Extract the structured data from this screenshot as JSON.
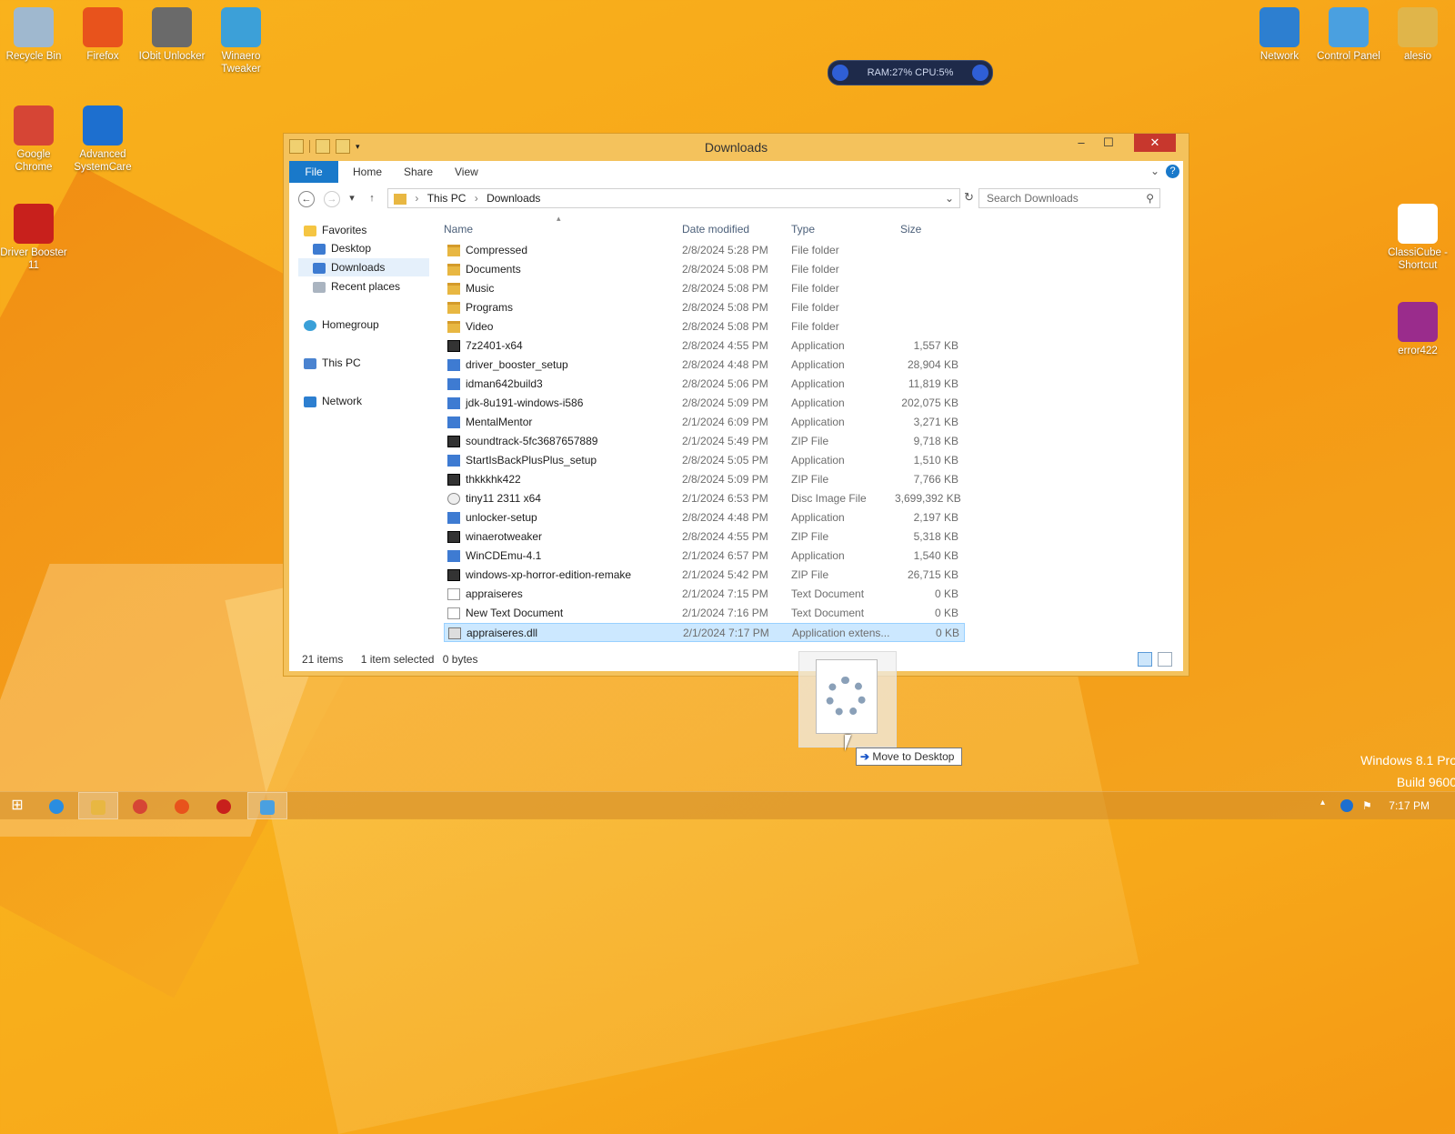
{
  "desktop": {
    "icons_left": [
      {
        "label": "Recycle Bin",
        "icon": "recycle-bin-icon",
        "color": "#9fb8cf"
      },
      {
        "label": "Firefox",
        "icon": "firefox-icon",
        "color": "#e8531c"
      },
      {
        "label": "IObit Unlocker",
        "icon": "lock-icon",
        "color": "#6a6a6a"
      },
      {
        "label": "Winaero Tweaker",
        "icon": "winaero-icon",
        "color": "#3ca0d8"
      },
      {
        "label": "Google Chrome",
        "icon": "chrome-icon",
        "color": "#d64535"
      },
      {
        "label": "Advanced SystemCare",
        "icon": "systemcare-icon",
        "color": "#1d6fcf"
      },
      {
        "label": "Driver Booster 11",
        "icon": "driver-booster-icon",
        "color": "#c8201c"
      }
    ],
    "icons_right": [
      {
        "label": "Network",
        "icon": "network-icon",
        "color": "#2d7fd0"
      },
      {
        "label": "Control Panel",
        "icon": "control-panel-icon",
        "color": "#4aa0e0"
      },
      {
        "label": "alesio",
        "icon": "user-folder-icon",
        "color": "#e0b54a"
      },
      {
        "label": "ClassiCube - Shortcut",
        "icon": "classicube-icon",
        "color": "#ffffff"
      },
      {
        "label": "error422",
        "icon": "error422-icon",
        "color": "#9a2c8c"
      }
    ],
    "widget": {
      "text": "RAM:27%   CPU:5%"
    },
    "watermark": {
      "line1": "Windows 8.1 Pro",
      "line2": "Build 9600"
    }
  },
  "explorer": {
    "title": "Downloads",
    "ribbon_tabs": [
      "File",
      "Home",
      "Share",
      "View"
    ],
    "breadcrumb": [
      "This PC",
      "Downloads"
    ],
    "search_placeholder": "Search Downloads",
    "nav": {
      "favorites": "Favorites",
      "desktop": "Desktop",
      "downloads": "Downloads",
      "recent": "Recent places",
      "homegroup": "Homegroup",
      "thispc": "This PC",
      "network": "Network"
    },
    "columns": {
      "name": "Name",
      "date": "Date modified",
      "type": "Type",
      "size": "Size"
    },
    "files": [
      {
        "name": "Compressed",
        "date": "2/8/2024 5:28 PM",
        "type": "File folder",
        "size": "",
        "icon": "folder"
      },
      {
        "name": "Documents",
        "date": "2/8/2024 5:08 PM",
        "type": "File folder",
        "size": "",
        "icon": "folder"
      },
      {
        "name": "Music",
        "date": "2/8/2024 5:08 PM",
        "type": "File folder",
        "size": "",
        "icon": "folder"
      },
      {
        "name": "Programs",
        "date": "2/8/2024 5:08 PM",
        "type": "File folder",
        "size": "",
        "icon": "folder"
      },
      {
        "name": "Video",
        "date": "2/8/2024 5:08 PM",
        "type": "File folder",
        "size": "",
        "icon": "folder"
      },
      {
        "name": "7z2401-x64",
        "date": "2/8/2024 4:55 PM",
        "type": "Application",
        "size": "1,557 KB",
        "icon": "zip"
      },
      {
        "name": "driver_booster_setup",
        "date": "2/8/2024 4:48 PM",
        "type": "Application",
        "size": "28,904 KB",
        "icon": "app"
      },
      {
        "name": "idman642build3",
        "date": "2/8/2024 5:06 PM",
        "type": "Application",
        "size": "11,819 KB",
        "icon": "app"
      },
      {
        "name": "jdk-8u191-windows-i586",
        "date": "2/8/2024 5:09 PM",
        "type": "Application",
        "size": "202,075 KB",
        "icon": "app"
      },
      {
        "name": "MentalMentor",
        "date": "2/1/2024 6:09 PM",
        "type": "Application",
        "size": "3,271 KB",
        "icon": "app"
      },
      {
        "name": "soundtrack-5fc3687657889",
        "date": "2/1/2024 5:49 PM",
        "type": "ZIP File",
        "size": "9,718 KB",
        "icon": "zip"
      },
      {
        "name": "StartIsBackPlusPlus_setup",
        "date": "2/8/2024 5:05 PM",
        "type": "Application",
        "size": "1,510 KB",
        "icon": "app"
      },
      {
        "name": "thkkkhk422",
        "date": "2/8/2024 5:09 PM",
        "type": "ZIP File",
        "size": "7,766 KB",
        "icon": "zip"
      },
      {
        "name": "tiny11 2311 x64",
        "date": "2/1/2024 6:53 PM",
        "type": "Disc Image File",
        "size": "3,699,392 KB",
        "icon": "disc"
      },
      {
        "name": "unlocker-setup",
        "date": "2/8/2024 4:48 PM",
        "type": "Application",
        "size": "2,197 KB",
        "icon": "app"
      },
      {
        "name": "winaerotweaker",
        "date": "2/8/2024 4:55 PM",
        "type": "ZIP File",
        "size": "5,318 KB",
        "icon": "zip"
      },
      {
        "name": "WinCDEmu-4.1",
        "date": "2/1/2024 6:57 PM",
        "type": "Application",
        "size": "1,540 KB",
        "icon": "app"
      },
      {
        "name": "windows-xp-horror-edition-remake",
        "date": "2/1/2024 5:42 PM",
        "type": "ZIP File",
        "size": "26,715 KB",
        "icon": "zip"
      },
      {
        "name": "appraiseres",
        "date": "2/1/2024 7:15 PM",
        "type": "Text Document",
        "size": "0 KB",
        "icon": "doc"
      },
      {
        "name": "New Text Document",
        "date": "2/1/2024 7:16 PM",
        "type": "Text Document",
        "size": "0 KB",
        "icon": "doc"
      },
      {
        "name": "appraiseres.dll",
        "date": "2/1/2024 7:17 PM",
        "type": "Application extens...",
        "size": "0 KB",
        "icon": "dll",
        "selected": true
      }
    ],
    "status": {
      "items": "21 items",
      "selected": "1 item selected",
      "bytes": "0 bytes"
    }
  },
  "drag": {
    "tooltip": "Move to Desktop"
  },
  "taskbar": {
    "clock": "7:17 PM"
  }
}
